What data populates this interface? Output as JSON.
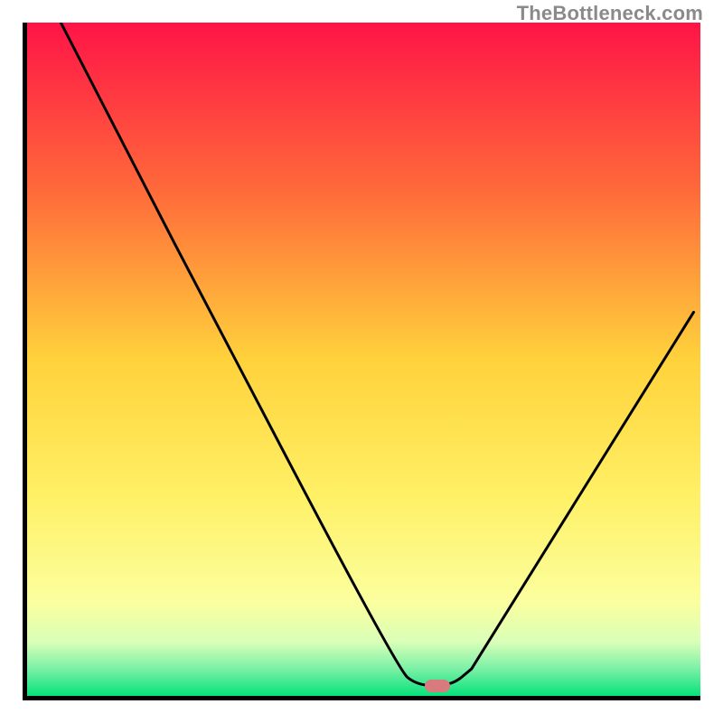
{
  "watermark": "TheBottleneck.com",
  "chart_data": {
    "type": "line",
    "title": "",
    "xlabel": "",
    "ylabel": "",
    "xlim": [
      0,
      100
    ],
    "ylim": [
      0,
      100
    ],
    "gradient_stops": [
      {
        "offset": 0,
        "color": "#ff1447"
      },
      {
        "offset": 25,
        "color": "#ff6a3a"
      },
      {
        "offset": 50,
        "color": "#ffd23b"
      },
      {
        "offset": 70,
        "color": "#fff065"
      },
      {
        "offset": 86,
        "color": "#fbff9e"
      },
      {
        "offset": 92,
        "color": "#d9ffb8"
      },
      {
        "offset": 96,
        "color": "#7af0a6"
      },
      {
        "offset": 100,
        "color": "#06e27a"
      }
    ],
    "series": [
      {
        "name": "bottleneck-curve",
        "points": [
          {
            "x": 5,
            "y": 100
          },
          {
            "x": 22,
            "y": 67
          },
          {
            "x": 55,
            "y": 4
          },
          {
            "x": 58,
            "y": 1.5
          },
          {
            "x": 63,
            "y": 1.5
          },
          {
            "x": 66,
            "y": 4
          },
          {
            "x": 99,
            "y": 57
          }
        ]
      }
    ],
    "marker": {
      "x": 61,
      "y": 1.5,
      "color": "#d87a7e"
    }
  }
}
